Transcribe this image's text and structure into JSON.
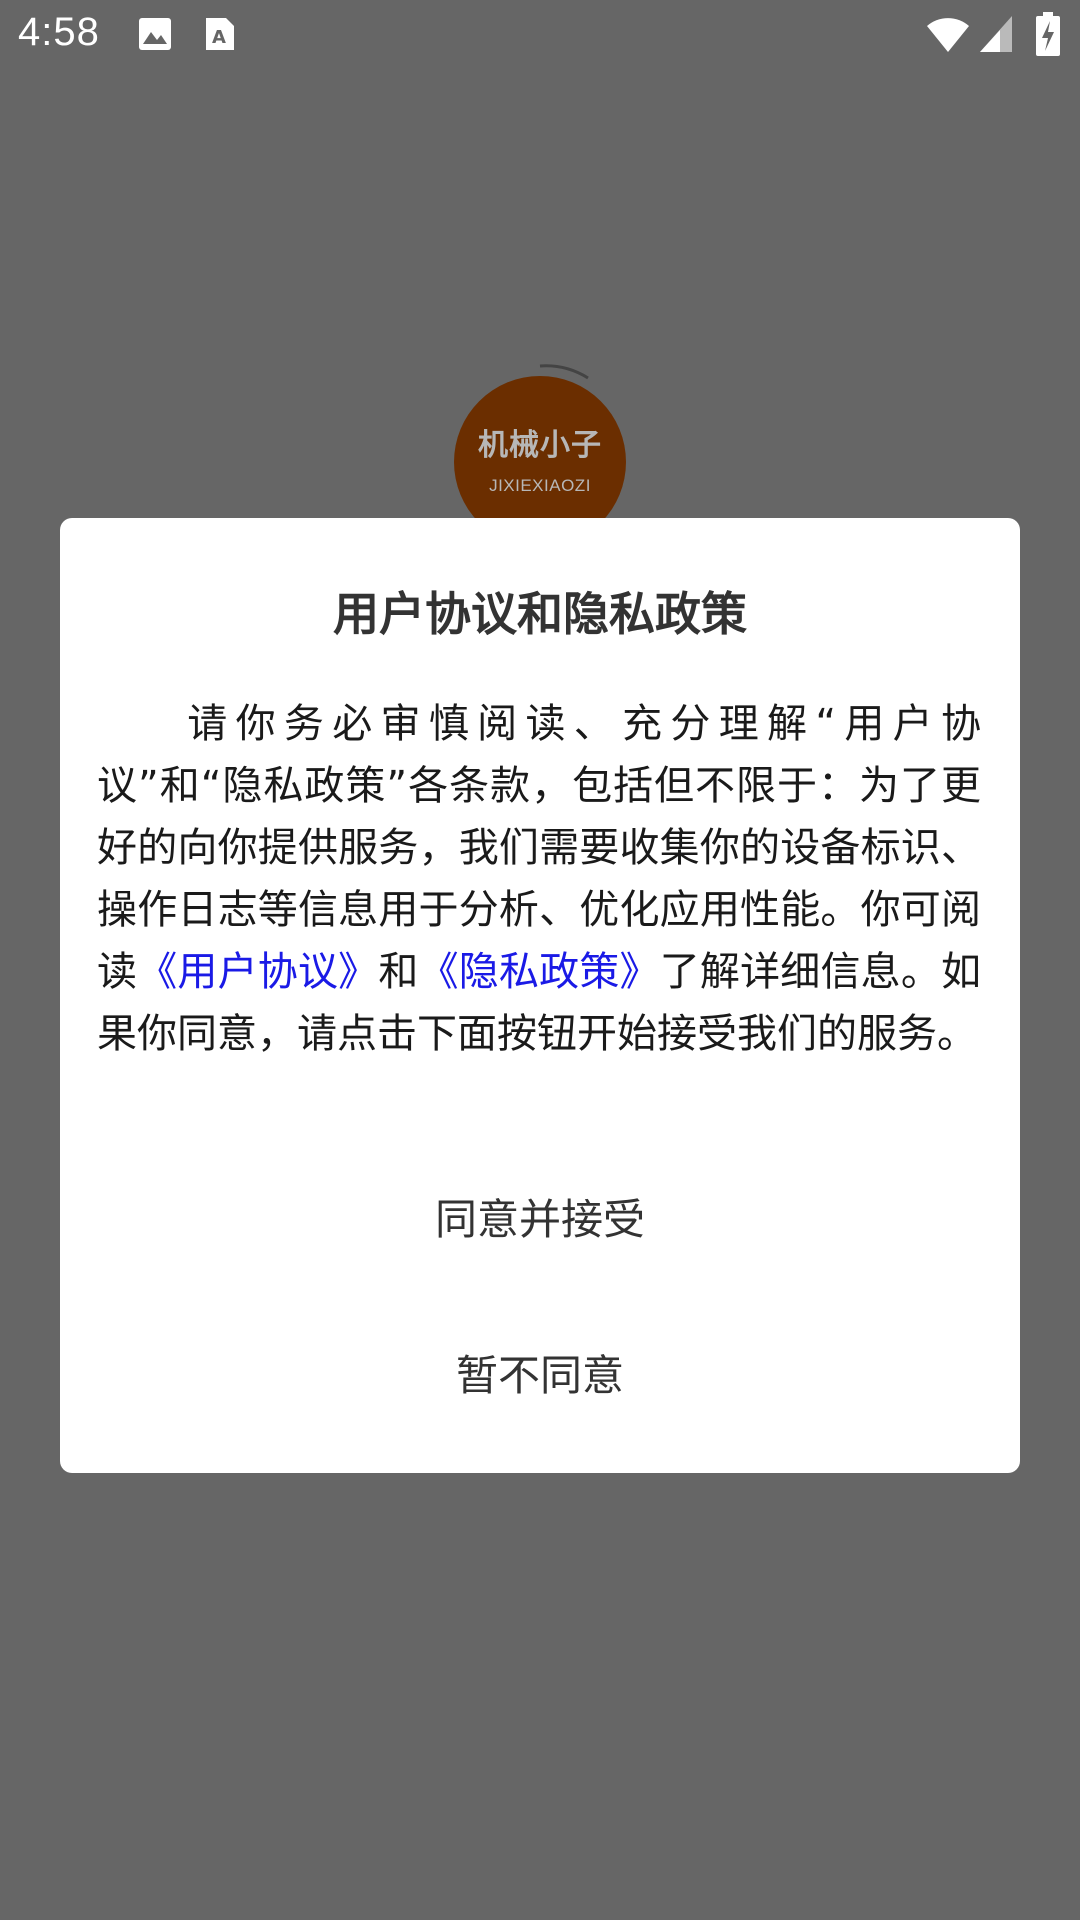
{
  "status_bar": {
    "time": "4:58",
    "icons": [
      "image-icon",
      "text-recognition-icon",
      "wifi-icon",
      "signal-icon",
      "battery-charging-icon"
    ]
  },
  "logo": {
    "text_cn": "机械小子",
    "text_en": "JIXIEXIAOZI",
    "color": "#6b2e00"
  },
  "dialog": {
    "title": "用户协议和隐私政策",
    "body": {
      "part1": "请你务必审慎阅读、充分理解“用户协议”和“隐私政策”各条款，包括但不限于：为了更好的向你提供服务，我们需要收集你的设备标识、操作日志等信息用于分析、优化应用性能。你可阅读",
      "link_user_agreement": "《用户协议》",
      "part2": "和",
      "link_privacy_policy": "《隐私政策》",
      "part3": "了解详细信息。如果你同意，请点击下面按钮开始接受我们的服务。"
    },
    "agree_button": "同意并接受",
    "decline_button": "暂不同意",
    "link_color": "#1a1ae6"
  }
}
